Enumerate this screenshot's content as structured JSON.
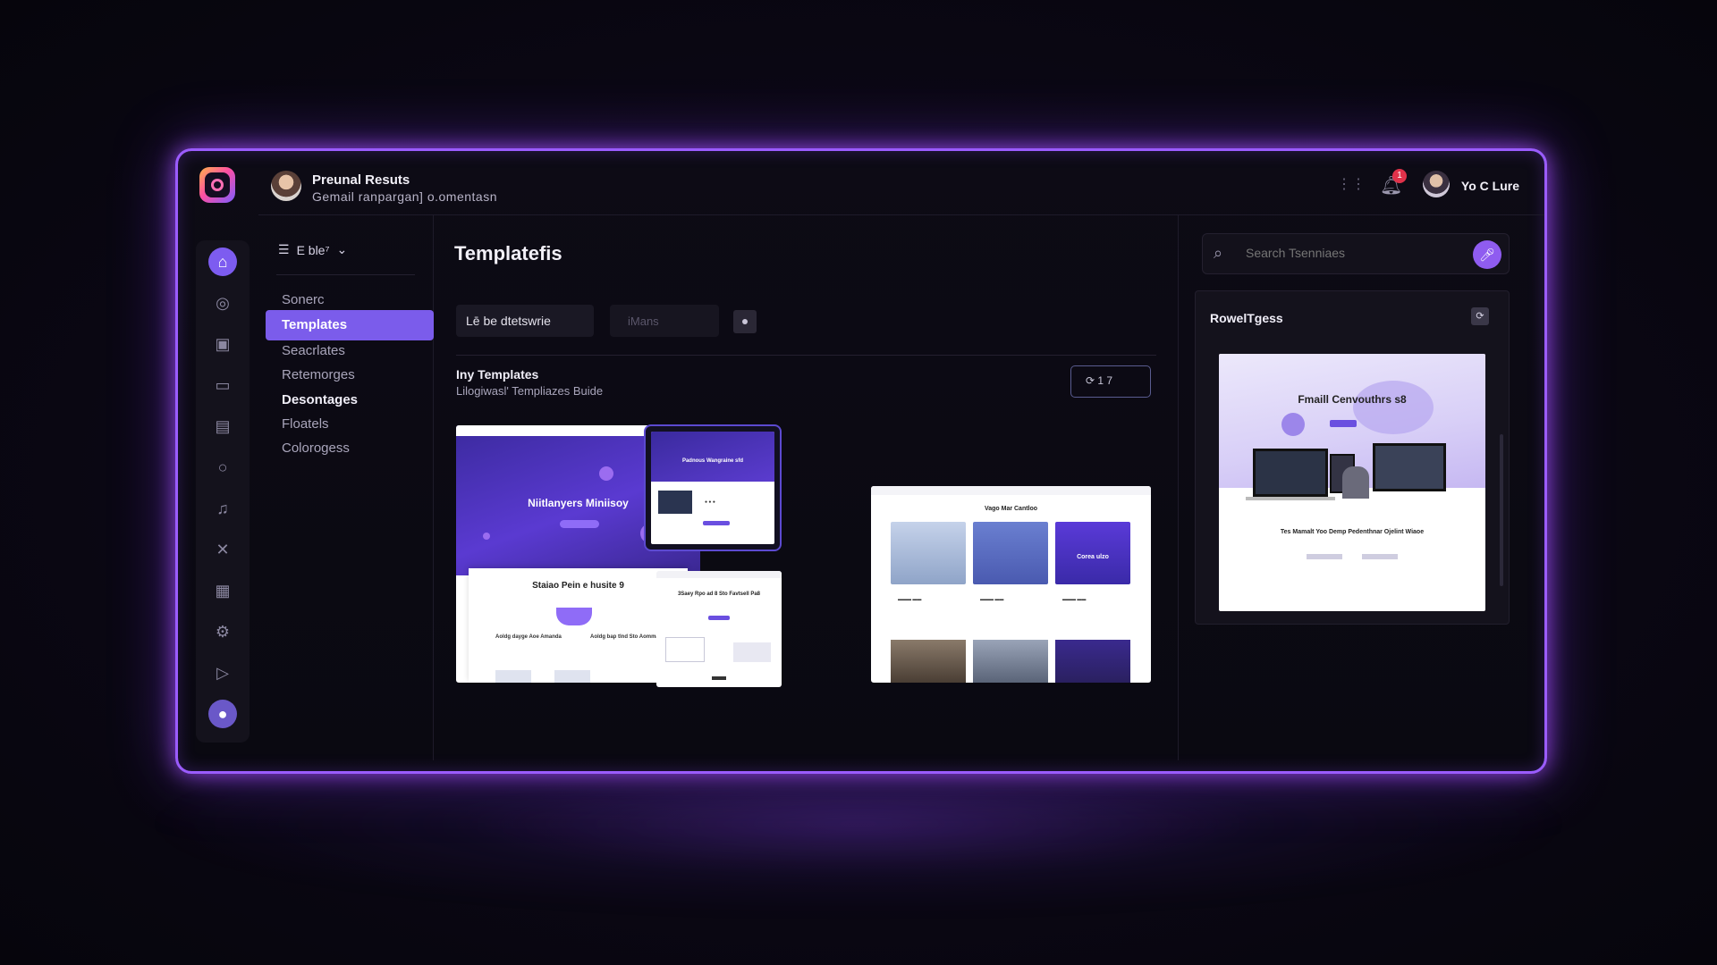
{
  "header": {
    "title": "Preunal Resuts",
    "subtitle": "Gemail ranpargan] o.omentasn",
    "notification_count": "1",
    "user_name": "Yo C Lure"
  },
  "rail": {
    "icons": [
      "home-icon",
      "target-icon",
      "image-icon",
      "inbox-icon",
      "monitor-icon",
      "chat-icon",
      "music-icon",
      "tools-icon",
      "layers-icon",
      "gear-icon",
      "play-icon",
      "user-icon"
    ]
  },
  "nav": {
    "header_label": "E ble⁷",
    "items": [
      {
        "label": "Sonerc"
      },
      {
        "label": "Templates"
      },
      {
        "label": "Seacrlates"
      },
      {
        "label": "Retemorges"
      },
      {
        "label": "Desontages"
      },
      {
        "label": "Floatels"
      },
      {
        "label": "Colorogess"
      }
    ]
  },
  "main": {
    "title": "Templatefis",
    "filter_value": "Lē be dtetswrie",
    "filter_placeholder": "iMans",
    "section_title": "Iny Templates",
    "section_subtitle": "Lilogiwasl' Templiazes Buide",
    "counter": "1 7",
    "cards": {
      "c1_title": "Niitlanyers Miniisoy",
      "c1_panel_title": "Staiao Pein e husite 9",
      "c1_text_a": "Aoldg dayge Aoe Amanda",
      "c1_text_b": "Aoldg bap tlnd Sto Aomma",
      "c2_title": "Padnous Wangraine sfd",
      "c3_title": "3Saey Rpo ad 8 Sto Favtsell Pa8",
      "c4_title": "Vago Mar Cantloo",
      "c4_badge": "Corea ulzo"
    }
  },
  "search": {
    "placeholder": "Search Tsenniaes"
  },
  "preview": {
    "title": "RowelTgess",
    "card_title": "Fmaill Cenvouthrs s8",
    "card_text": "Tes Mamalt Yoo Demp Pedenthnar Ojelint Wiaoe"
  }
}
